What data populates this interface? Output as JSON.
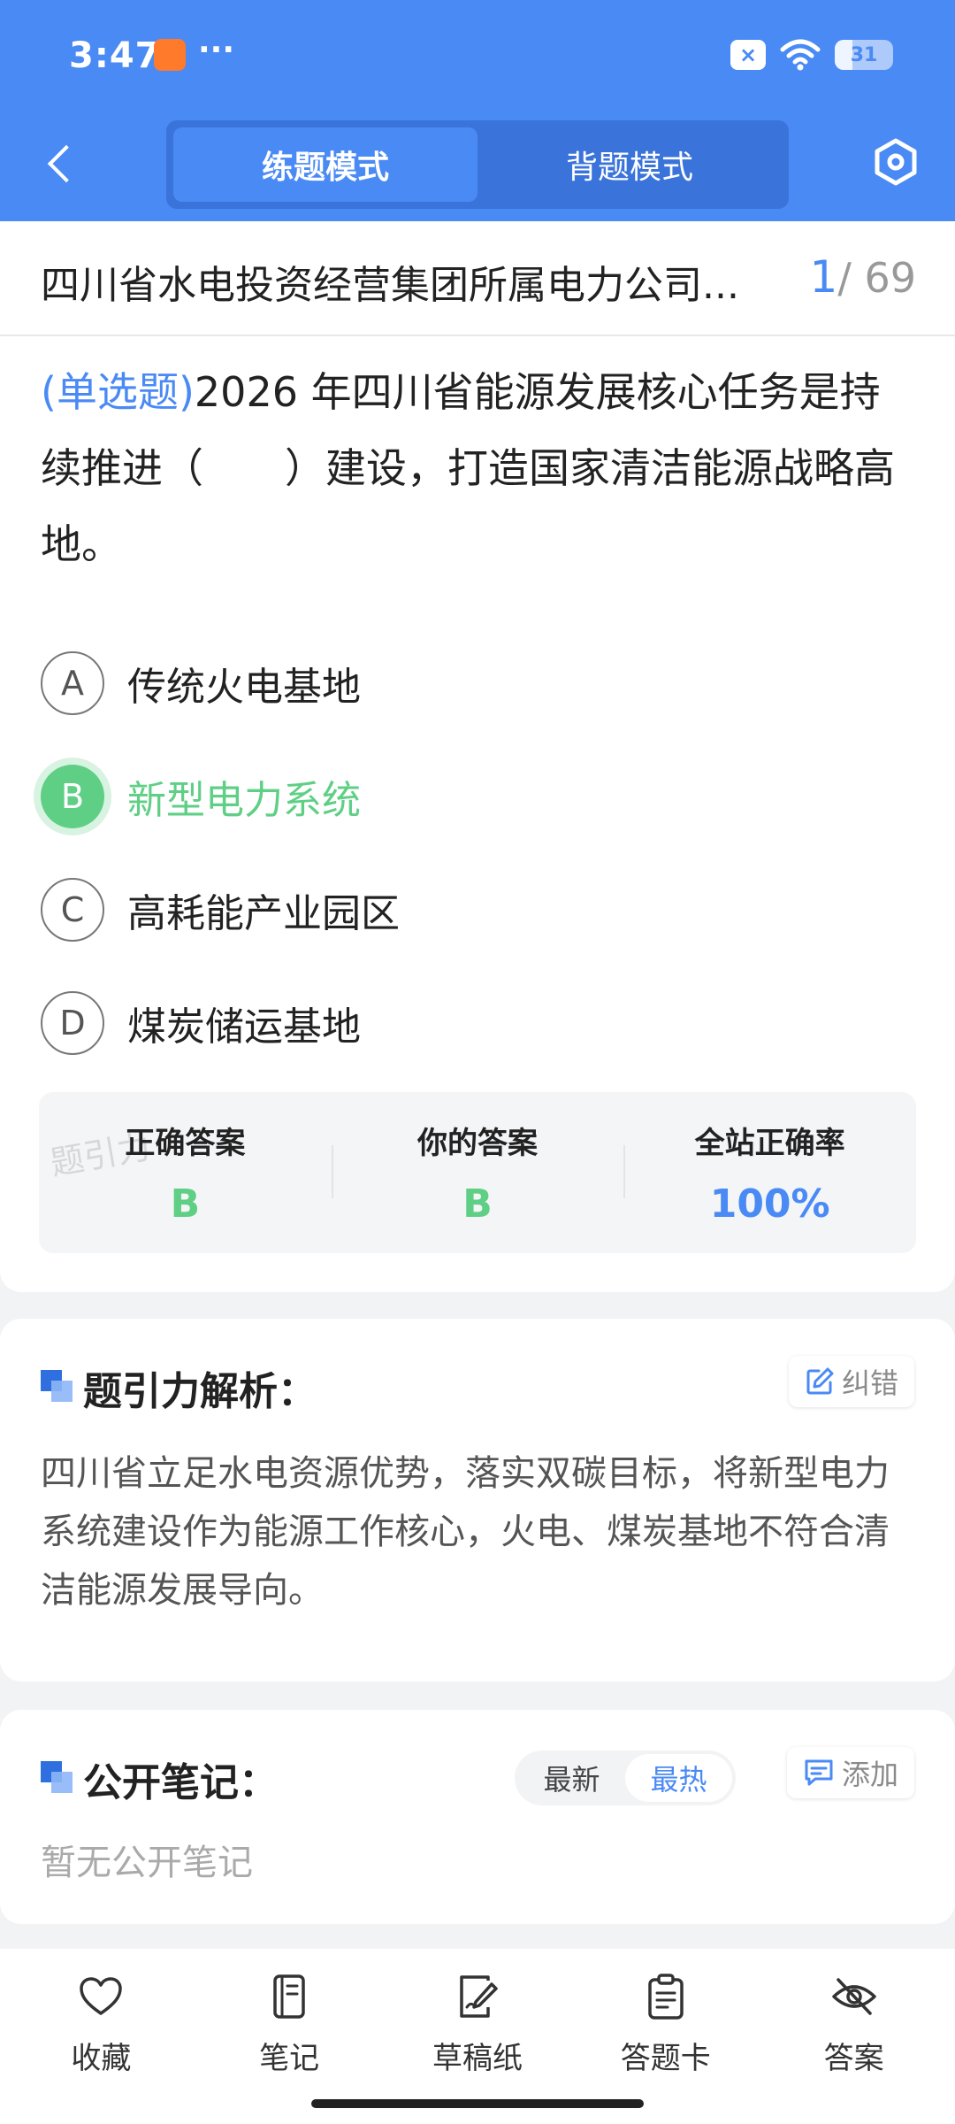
{
  "status_bar": {
    "time": "3:47",
    "more": "···",
    "battery": "31"
  },
  "nav": {
    "modes": [
      {
        "label": "练题模式",
        "active": true
      },
      {
        "label": "背题模式",
        "active": false
      }
    ]
  },
  "paper": {
    "title": "四川省水电投资经营集团所属电力公司...",
    "current": "1",
    "total": "/ 69"
  },
  "question": {
    "type": "(单选题)",
    "text": "2026 年四川省能源发展核心任务是持续推进（　　）建设，打造国家清洁能源战略高地。",
    "options": [
      {
        "letter": "A",
        "text": "传统火电基地"
      },
      {
        "letter": "B",
        "text": "新型电力系统",
        "state": "correct"
      },
      {
        "letter": "C",
        "text": "高耗能产业园区"
      },
      {
        "letter": "D",
        "text": "煤炭储运基地"
      }
    ]
  },
  "stats": {
    "watermark": "题引力",
    "correct_label": "正确答案",
    "correct_value": "B",
    "yours_label": "你的答案",
    "yours_value": "B",
    "rate_label": "全站正确率",
    "rate_value": "100%"
  },
  "analysis": {
    "title": "题引力解析：",
    "report_label": "纠错",
    "text": "四川省立足水电资源优势，落实双碳目标，将新型电力系统建设作为能源工作核心，火电、煤炭基地不符合清洁能源发展导向。"
  },
  "notes": {
    "title": "公开笔记：",
    "sort_latest": "最新",
    "sort_hot": "最热",
    "add_label": "添加",
    "empty": "暂无公开笔记"
  },
  "tabbar": [
    {
      "label": "收藏",
      "icon": "heart-icon"
    },
    {
      "label": "笔记",
      "icon": "notebook-icon"
    },
    {
      "label": "草稿纸",
      "icon": "draft-pen-icon"
    },
    {
      "label": "答题卡",
      "icon": "clipboard-icon"
    },
    {
      "label": "答案",
      "icon": "eye-off-icon"
    }
  ],
  "colors": {
    "primary": "#4a8af4",
    "correct": "#5fcf85"
  }
}
